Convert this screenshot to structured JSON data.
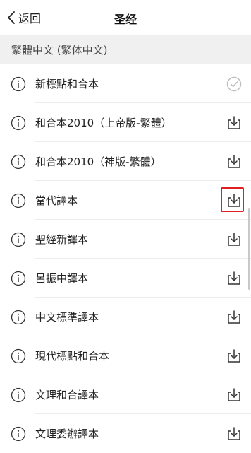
{
  "header": {
    "back_label": "返回",
    "title": "圣经"
  },
  "section": {
    "title": "繁體中文 (繁体中文)"
  },
  "items": [
    {
      "label": "新標點和合本",
      "status": "downloaded"
    },
    {
      "label": "和合本2010（上帝版-繁體）",
      "status": "download"
    },
    {
      "label": "和合本2010（神版-繁體）",
      "status": "download"
    },
    {
      "label": "當代譯本",
      "status": "download",
      "highlighted": true
    },
    {
      "label": "聖經新譯本",
      "status": "download"
    },
    {
      "label": "呂振中譯本",
      "status": "download"
    },
    {
      "label": "中文標準譯本",
      "status": "download"
    },
    {
      "label": "現代標點和合本",
      "status": "download"
    },
    {
      "label": "文理和合譯本",
      "status": "download"
    },
    {
      "label": "文理委辦譯本",
      "status": "download"
    }
  ],
  "colors": {
    "highlight": "#e02020",
    "section_bg": "#f0f0f0",
    "icon": "#333333",
    "check": "#bbbbbb"
  }
}
